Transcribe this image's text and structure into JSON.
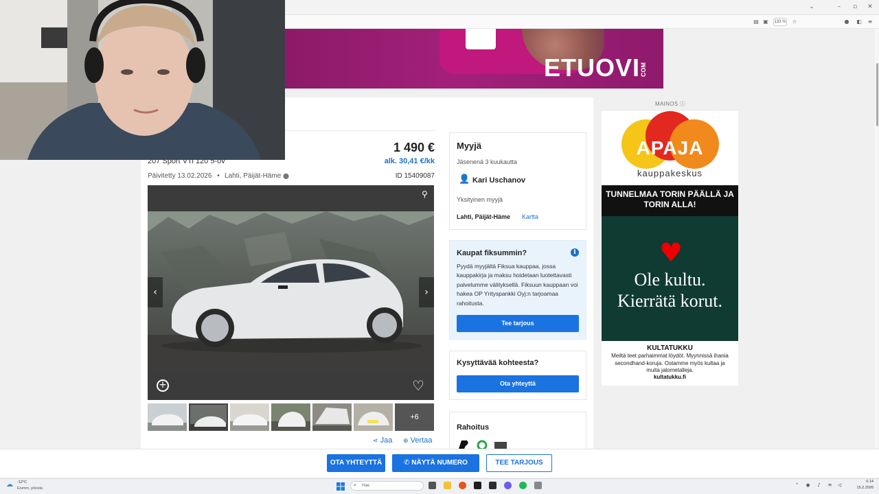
{
  "browser": {
    "zoom": "133 %",
    "window_controls": [
      "minimize",
      "maximize",
      "close"
    ]
  },
  "banner": {
    "brand": "ETUOVI",
    "suffix": "COM"
  },
  "listing": {
    "subtitle": "207 Sport VTi 120 5-ov",
    "price": "1 490 €",
    "monthly": "alk. 30,41 €/kk",
    "updated": "Päivitetty 13.02.2026",
    "separator": "•",
    "location": "Lahti, Päijät-Häme",
    "id": "ID 15409087",
    "more_photos": "+6",
    "share": "Jaa",
    "compare": "Vertaa"
  },
  "seller": {
    "heading": "Myyjä",
    "member": "Jäsenenä 3 kuukautta",
    "name": "Kari Uschanov",
    "type": "Yksityinen myyjä",
    "location": "Lahti, Päijät-Häme",
    "map_link": "Kartta"
  },
  "fiksu": {
    "heading": "Kaupat fiksummin?",
    "text": "Pyydä myyjältä Fiksua kauppaa, jossa kauppakirja ja maksu hoidetaan luotettavasti palvelumme välityksellä. Fiksuun kauppaan voi hakea OP Yrityspankki Oyj:n tarjoamaa rahoitusta.",
    "button": "Tee tarjous"
  },
  "question": {
    "heading": "Kysyttävää kohteesta?",
    "button": "Ota yhteyttä"
  },
  "finance": {
    "heading": "Rahoitus"
  },
  "ad": {
    "label": "MAINOS",
    "apaja": "APAJA",
    "apaja_sub": "kauppakeskus",
    "slogan": "TUNNELMAA TORIN PÄÄLLÄ JA TORIN ALLA!",
    "line1": "Ole kultu.",
    "line2": "Kierrätä korut.",
    "company": "KULTATUKKU",
    "text": "Meiltä teet parhaimmat löydöt. Myynnissä ihania secondhand-koruja. Ostamme myös kultaa ja muita jalometalleja.",
    "url": "kultatukku.fi"
  },
  "actions": {
    "contact": "OTA YHTEYTTÄ",
    "number": "NÄYTÄ NUMERO",
    "offer": "TEE TARJOUS"
  },
  "taskbar": {
    "temp": "-12°C",
    "weather": "Enimm. pilvistä",
    "search": "Hae",
    "time": "0.14",
    "date": "15.2.2026"
  },
  "colors": {
    "accent": "#1a73e0",
    "banner": "#a3207a",
    "ad_green": "#0f3b33"
  }
}
